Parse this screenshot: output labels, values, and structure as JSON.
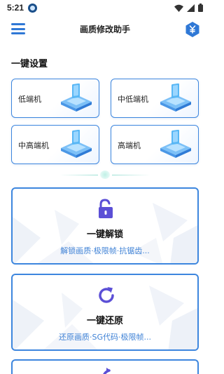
{
  "status_bar": {
    "time": "5:21",
    "icons": [
      "app-icon",
      "wifi-icon",
      "signal-icon",
      "battery-icon"
    ]
  },
  "app_bar": {
    "title": "画质修改助手",
    "left_icon": "menu-icon",
    "right_icon": "hex-currency-icon"
  },
  "section_title": "一键设置",
  "presets": [
    {
      "label": "低端机"
    },
    {
      "label": "中低端机"
    },
    {
      "label": "中高端机"
    },
    {
      "label": "高端机"
    }
  ],
  "actions": [
    {
      "title": "一键解锁",
      "subtitle": "解锁画质·极限帧·抗锯齿...",
      "icon": "unlock-icon"
    },
    {
      "title": "一键还原",
      "subtitle": "还原画质·SG代码·极限帧...",
      "icon": "refresh-icon"
    }
  ],
  "colors": {
    "accent": "#3d86de",
    "subtitle": "#3f82d6",
    "icon_purple": "#5b4fd6",
    "divider": "#50c8b4"
  }
}
